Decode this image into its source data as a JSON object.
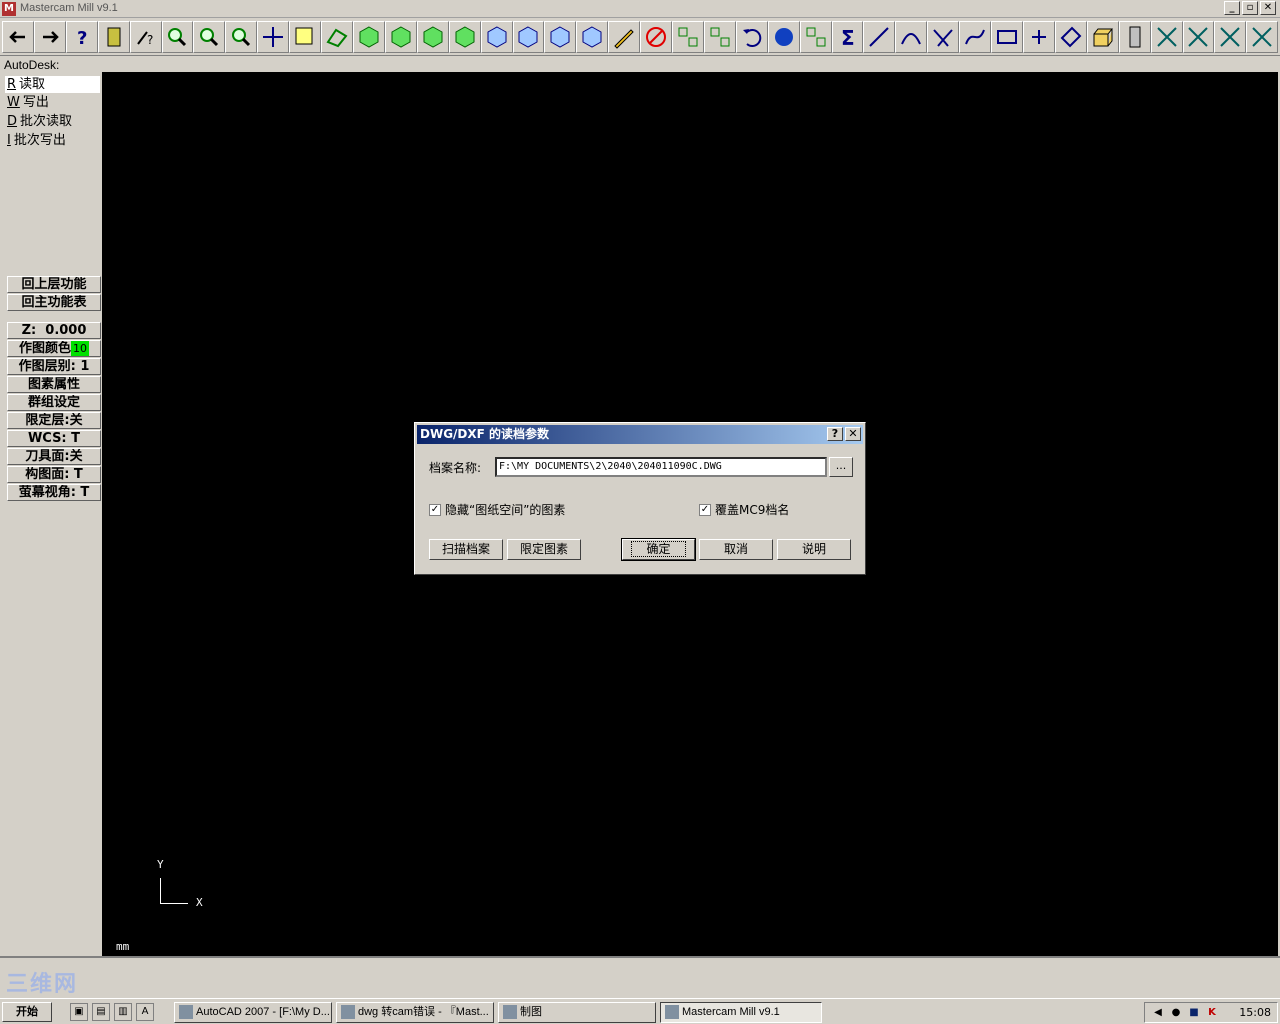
{
  "window": {
    "title": "Mastercam Mill v9.1",
    "min": "_",
    "max": "▫",
    "close": "✕"
  },
  "toolbar": {
    "icons": [
      "back-icon",
      "forward-icon",
      "help-icon",
      "calculator-icon",
      "analyze-icon",
      "zoom-window-icon",
      "zoom-out-icon",
      "zoom-fit-icon",
      "pan-icon",
      "select-icon",
      "rotate-icon",
      "iso-view-green-icon",
      "top-view-green-icon",
      "front-view-green-icon",
      "side-view-green-icon",
      "cube-view-blue-1-icon",
      "cube-view-blue-2-icon",
      "cube-view-blue-3-icon",
      "cube-view-blue-4-icon",
      "pencil-icon",
      "delete-icon",
      "translate-icon",
      "transform-icon",
      "undo-icon",
      "sphere-icon",
      "group-icon",
      "sum-icon",
      "line-icon",
      "arc-icon",
      "fillet-icon",
      "spline-icon",
      "rectangle-icon",
      "point-icon",
      "surface-icon",
      "solid-icon",
      "tree-icon",
      "trim-1-icon",
      "trim-2-icon",
      "trim-3-icon",
      "trim-4-icon"
    ]
  },
  "prompt": "AutoDesk:",
  "menu": {
    "items": [
      {
        "key": "R",
        "label": "读取"
      },
      {
        "key": "W",
        "label": "写出"
      },
      {
        "key": "D",
        "label": "批次读取"
      },
      {
        "key": "I",
        "label": "批次写出"
      }
    ],
    "back_label": "回上层功能",
    "main_label": "回主功能表"
  },
  "status": {
    "z_label": "Z:",
    "z_value": "0.000",
    "color_label": "作图颜色",
    "color_value": "10",
    "level": "作图层别:  1",
    "attributes": "图素属性",
    "group": "群组设定",
    "mask": "限定层:关",
    "wcs": "WCS:   T",
    "tplane": "刀具面:关",
    "cplane": "构图面:  T",
    "gview": "萤幕视角:  T"
  },
  "canvas": {
    "y_axis": "Y",
    "x_axis": "X",
    "units": "mm"
  },
  "watermark": "三维网",
  "dialog": {
    "title": "DWG/DXF 的读档参数",
    "help": "?",
    "close": "✕",
    "filename_label": "档案名称:",
    "filename_value": "F:\\MY DOCUMENTS\\2\\2040\\204011090C.DWG",
    "browse": "...",
    "hide_paper_label": "隐藏“图纸空间”的图素",
    "overwrite_label": "覆盖MC9档名",
    "hide_paper_checked": true,
    "overwrite_checked": true,
    "scan_button": "扫描档案",
    "limit_button": "限定图素",
    "ok_button": "确定",
    "cancel_button": "取消",
    "help_button": "说明"
  },
  "taskbar": {
    "start": "开始",
    "tasks": [
      "AutoCAD 2007 - [F:\\My D...",
      "dwg 转cam错误 - 『Mast...",
      "制图",
      "Mastercam Mill v9.1"
    ],
    "clock": "15:08"
  }
}
